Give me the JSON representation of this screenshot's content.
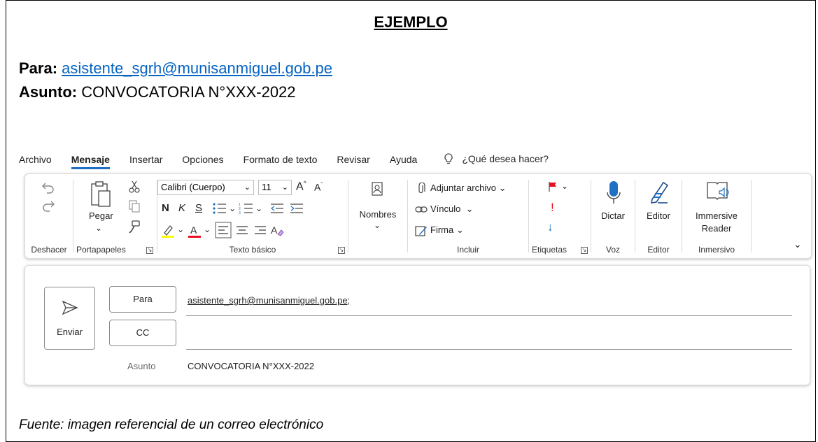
{
  "document": {
    "title": "EJEMPLO",
    "para_label": "Para:",
    "para_value": "asistente_sgrh@munisanmiguel.gob.pe",
    "asunto_label": "Asunto:",
    "asunto_value": "CONVOCATORIA N°XXX-2022",
    "footer": "Fuente: imagen referencial de un correo electrónico"
  },
  "tabs": [
    "Archivo",
    "Mensaje",
    "Insertar",
    "Opciones",
    "Formato de texto",
    "Revisar",
    "Ayuda"
  ],
  "active_tab": "Mensaje",
  "search_prompt": "¿Qué desea hacer?",
  "ribbon": {
    "deshacer": {
      "label": "Deshacer"
    },
    "portapapeles": {
      "label": "Portapapeles",
      "pegar": "Pegar"
    },
    "texto_basico": {
      "label": "Texto básico",
      "font": "Calibri (Cuerpo)",
      "size": "11",
      "bold": "N",
      "italic": "K",
      "underline": "S"
    },
    "nombres": {
      "label": "Nombres"
    },
    "incluir": {
      "label": "Incluir",
      "adjuntar": "Adjuntar archivo",
      "vinculo": "Vínculo",
      "firma": "Firma"
    },
    "etiquetas": {
      "label": "Etiquetas"
    },
    "voz": {
      "label": "Voz",
      "dictar": "Dictar"
    },
    "editor": {
      "label": "Editor",
      "editor": "Editor"
    },
    "inmersivo": {
      "label": "Inmersivo",
      "reader_1": "Immersive",
      "reader_2": "Reader"
    }
  },
  "compose": {
    "send": "Enviar",
    "to_button": "Para",
    "cc_button": "CC",
    "to_value": "asistente_sgrh@munisanmiguel.gob.pe;",
    "subject_label": "Asunto",
    "subject_value": "CONVOCATORIA N°XXX-2022"
  },
  "colors": {
    "accent": "#1f6fc4",
    "link": "#0563c1",
    "highlight": "#ffff00",
    "font_color": "#e81123",
    "flag": "#e81123"
  }
}
